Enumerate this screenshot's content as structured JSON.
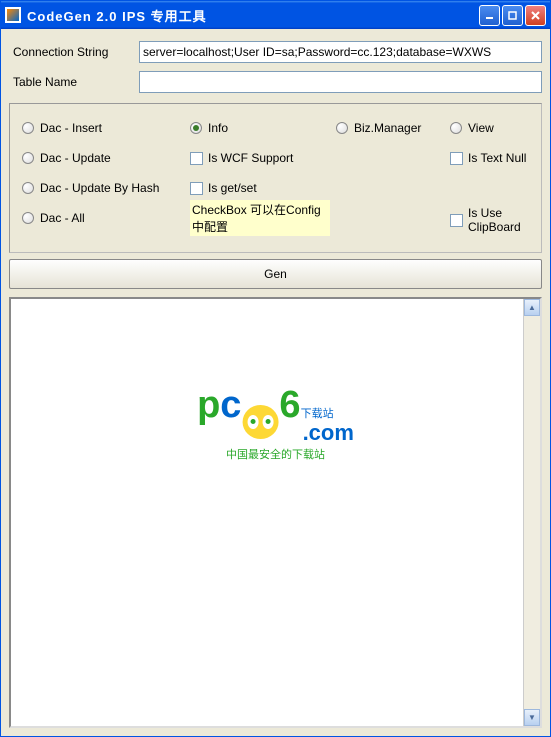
{
  "window": {
    "title": "CodeGen 2.0 IPS 专用工具"
  },
  "fields": {
    "conn_label": "Connection String",
    "conn_value": "server=localhost;User ID=sa;Password=cc.123;database=WXWS",
    "table_label": "Table Name",
    "table_value": ""
  },
  "radios": {
    "dac_insert": "Dac - Insert",
    "dac_update": "Dac - Update",
    "dac_update_hash": "Dac - Update By Hash",
    "dac_all": "Dac - All",
    "info": "Info",
    "biz_manager": "Biz.Manager",
    "view": "View"
  },
  "checks": {
    "wcf": "Is WCF Support",
    "getset": "Is get/set",
    "textnull": "Is Text Null",
    "clipboard": "Is Use ClipBoard"
  },
  "hint": "CheckBox 可以在Config中配置",
  "gen_button": "Gen",
  "logo": {
    "text_dl": "下载站",
    "com": ".com",
    "sub": "中国最安全的下载站"
  }
}
